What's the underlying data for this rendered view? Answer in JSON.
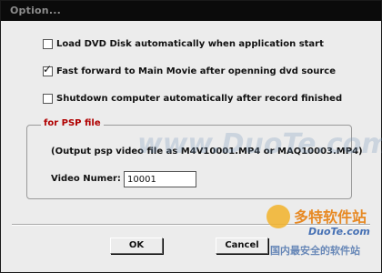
{
  "window": {
    "title": "Option..."
  },
  "options": [
    {
      "label": "Load DVD Disk automatically when application start",
      "checked": false
    },
    {
      "label": "Fast forward to Main Movie after openning dvd source",
      "checked": true
    },
    {
      "label": "Shutdown computer automatically after record finished",
      "checked": false
    }
  ],
  "psp": {
    "legend": "for PSP file",
    "info": "(Output psp video file as M4V10001.MP4 or MAQ10003.MP4)",
    "video_number_label": "Video Numer:",
    "video_number_value": "10001"
  },
  "buttons": {
    "ok": "OK",
    "cancel": "Cancel"
  },
  "watermark": {
    "site": "www.DuoTe.com",
    "brand": "多特软件站",
    "brand_url": "DuoTe.com",
    "slogan": "国内最安全的软件站"
  },
  "colors": {
    "titlebar": "#0b0b0b",
    "title_text": "#8c8c8c",
    "legend_text": "#b00000",
    "dialog_bg": "#ececec"
  }
}
